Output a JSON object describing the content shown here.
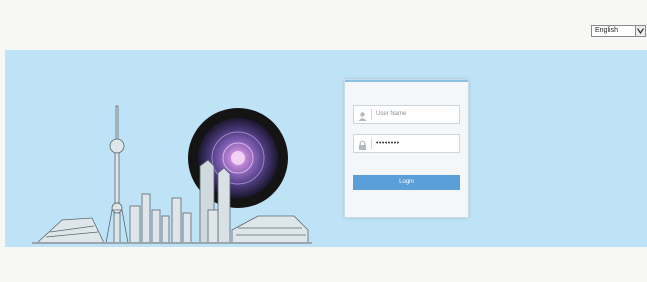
{
  "header": {
    "language_select": {
      "selected": "English"
    }
  },
  "login": {
    "username_placeholder": "User Name",
    "password_value": "••••••••",
    "login_label": "Login"
  },
  "colors": {
    "band": "#bfe3f6",
    "button": "#5a9fd8"
  },
  "icons": [
    "user-icon",
    "lock-icon",
    "chevron-down-icon"
  ]
}
